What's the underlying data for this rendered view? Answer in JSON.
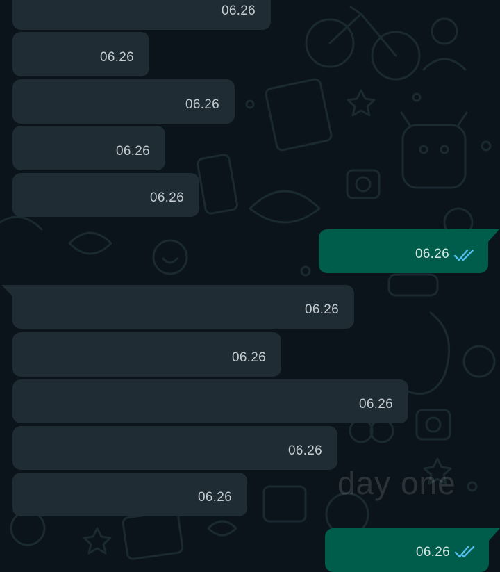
{
  "chat": {
    "messages": [
      {
        "direction": "in",
        "time": "06.26"
      },
      {
        "direction": "in",
        "time": "06.26"
      },
      {
        "direction": "in",
        "time": "06.26"
      },
      {
        "direction": "in",
        "time": "06.26"
      },
      {
        "direction": "in",
        "time": "06.26"
      },
      {
        "direction": "out",
        "time": "06.26",
        "status": "read-double-check-icon"
      },
      {
        "direction": "in",
        "time": "06.26"
      },
      {
        "direction": "in",
        "time": "06.26"
      },
      {
        "direction": "in",
        "time": "06.26"
      },
      {
        "direction": "in",
        "time": "06.26"
      },
      {
        "direction": "in",
        "time": "06.26"
      },
      {
        "direction": "out",
        "time": "06.26",
        "status": "read-double-check-icon"
      }
    ]
  },
  "watermark": "day one",
  "colors": {
    "background": "#0b141a",
    "incoming_bubble": "#1f2c34",
    "outgoing_bubble": "#005c4b",
    "read_tick": "#53bdeb"
  }
}
